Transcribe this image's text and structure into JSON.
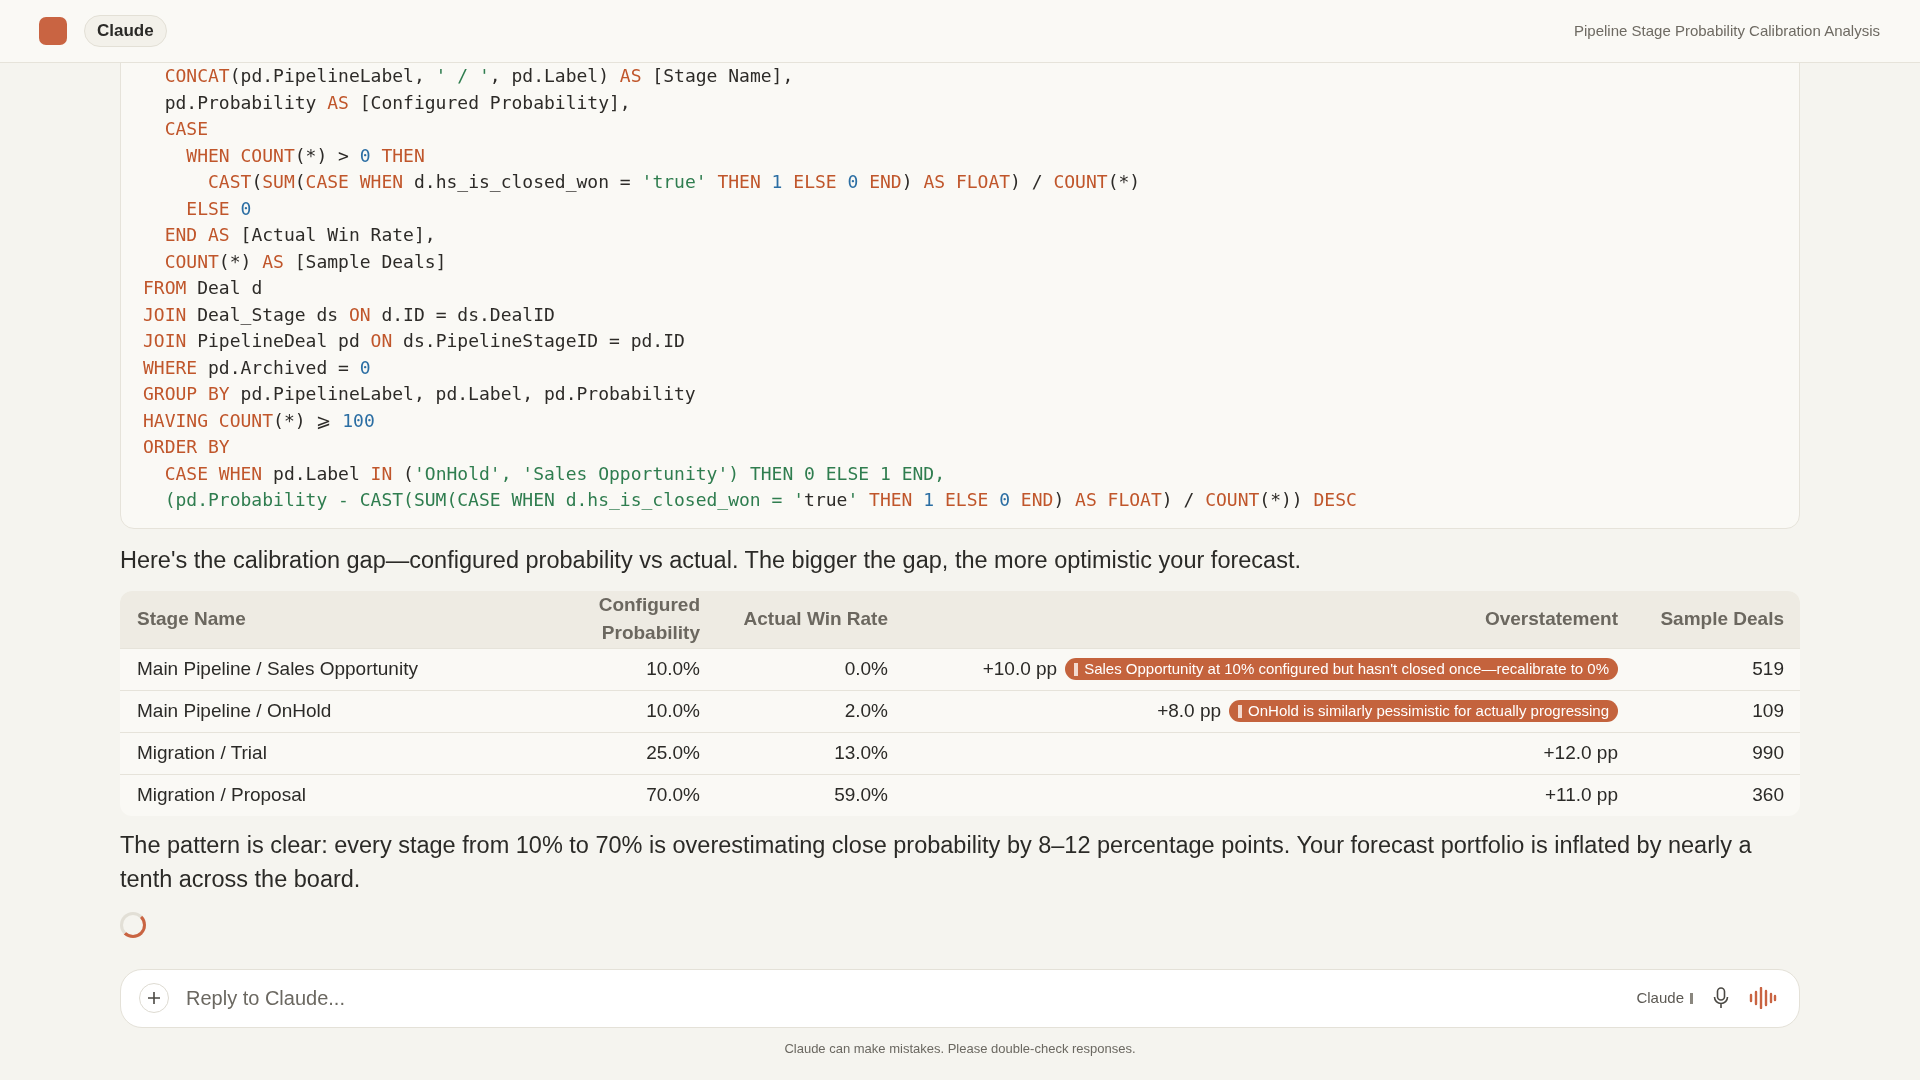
{
  "header": {
    "app_name": "Claude",
    "title": "Pipeline Stage Probability Calibration Analysis"
  },
  "code_lines": [
    [
      {
        "text": "  CONCAT",
        "kind": "kw"
      },
      {
        "text": "(pd.PipelineLabel, ",
        "kind": "plain"
      },
      {
        "text": "' / '",
        "kind": "str"
      },
      {
        "text": ", pd.Label) ",
        "kind": "plain"
      },
      {
        "text": "AS",
        "kind": "kw"
      },
      {
        "text": " [Stage Name],",
        "kind": "plain"
      }
    ],
    [
      {
        "text": "  pd.Probability ",
        "kind": "plain"
      },
      {
        "text": "AS",
        "kind": "kw"
      },
      {
        "text": " [Configured Probability],",
        "kind": "plain"
      }
    ],
    [
      {
        "text": "  CASE",
        "kind": "kw"
      }
    ],
    [
      {
        "text": "    WHEN COUNT",
        "kind": "kw"
      },
      {
        "text": "(*) > ",
        "kind": "plain"
      },
      {
        "text": "0",
        "kind": "num"
      },
      {
        "text": " THEN",
        "kind": "kw"
      }
    ],
    [
      {
        "text": "      CAST",
        "kind": "kw"
      },
      {
        "text": "(",
        "kind": "plain"
      },
      {
        "text": "SUM",
        "kind": "kw"
      },
      {
        "text": "(",
        "kind": "plain"
      },
      {
        "text": "CASE WHEN",
        "kind": "kw"
      },
      {
        "text": " d.hs_is_closed_won = ",
        "kind": "plain"
      },
      {
        "text": "'true'",
        "kind": "str"
      },
      {
        "text": " THEN ",
        "kind": "kw"
      },
      {
        "text": "1",
        "kind": "num"
      },
      {
        "text": " ELSE ",
        "kind": "kw"
      },
      {
        "text": "0",
        "kind": "num"
      },
      {
        "text": " END",
        "kind": "kw"
      },
      {
        "text": ") ",
        "kind": "plain"
      },
      {
        "text": "AS FLOAT",
        "kind": "kw"
      },
      {
        "text": ") / ",
        "kind": "plain"
      },
      {
        "text": "COUNT",
        "kind": "kw"
      },
      {
        "text": "(*)",
        "kind": "plain"
      }
    ],
    [
      {
        "text": "    ELSE ",
        "kind": "kw"
      },
      {
        "text": "0",
        "kind": "num"
      }
    ],
    [
      {
        "text": "  END AS",
        "kind": "kw"
      },
      {
        "text": " [Actual Win Rate],",
        "kind": "plain"
      }
    ],
    [
      {
        "text": "  COUNT",
        "kind": "kw"
      },
      {
        "text": "(*) ",
        "kind": "plain"
      },
      {
        "text": "AS",
        "kind": "kw"
      },
      {
        "text": " [Sample Deals]",
        "kind": "plain"
      }
    ],
    [
      {
        "text": "FROM",
        "kind": "kw"
      },
      {
        "text": " Deal d",
        "kind": "plain"
      }
    ],
    [
      {
        "text": "JOIN",
        "kind": "kw"
      },
      {
        "text": " Deal_Stage ds ",
        "kind": "plain"
      },
      {
        "text": "ON",
        "kind": "kw"
      },
      {
        "text": " d.ID = ds.DealID",
        "kind": "plain"
      }
    ],
    [
      {
        "text": "JOIN",
        "kind": "kw"
      },
      {
        "text": " PipelineDeal pd ",
        "kind": "plain"
      },
      {
        "text": "ON",
        "kind": "kw"
      },
      {
        "text": " ds.PipelineStageID = pd.ID",
        "kind": "plain"
      }
    ],
    [
      {
        "text": "WHERE",
        "kind": "kw"
      },
      {
        "text": " pd.Archived = ",
        "kind": "plain"
      },
      {
        "text": "0",
        "kind": "num"
      }
    ],
    [
      {
        "text": "GROUP BY",
        "kind": "kw"
      },
      {
        "text": " pd.PipelineLabel, pd.Label, pd.Probability",
        "kind": "plain"
      }
    ],
    [
      {
        "text": "HAVING COUNT",
        "kind": "kw"
      },
      {
        "text": "(*) ⩾ ",
        "kind": "plain"
      },
      {
        "text": "100",
        "kind": "num"
      }
    ],
    [
      {
        "text": "ORDER BY",
        "kind": "kw"
      }
    ],
    [
      {
        "text": "  CASE WHEN",
        "kind": "kw"
      },
      {
        "text": " pd.Label ",
        "kind": "plain"
      },
      {
        "text": "IN",
        "kind": "kw"
      },
      {
        "text": " (",
        "kind": "plain"
      },
      {
        "text": "'OnHold', 'Sales Opportunity') THEN 0 ELSE 1 END,",
        "kind": "str"
      }
    ],
    [
      {
        "text": "  (pd.Probability - CAST(SUM(CASE WHEN d.hs_is_closed_won = '",
        "kind": "str"
      },
      {
        "text": "true",
        "kind": "plain"
      },
      {
        "text": "'",
        "kind": "str"
      },
      {
        "text": " THEN ",
        "kind": "kw"
      },
      {
        "text": "1",
        "kind": "num"
      },
      {
        "text": " ELSE ",
        "kind": "kw"
      },
      {
        "text": "0",
        "kind": "num"
      },
      {
        "text": " END",
        "kind": "kw"
      },
      {
        "text": ") ",
        "kind": "plain"
      },
      {
        "text": "AS FLOAT",
        "kind": "kw"
      },
      {
        "text": ") / ",
        "kind": "plain"
      },
      {
        "text": "COUNT",
        "kind": "kw"
      },
      {
        "text": "(*)) ",
        "kind": "plain"
      },
      {
        "text": "DESC",
        "kind": "kw"
      }
    ]
  ],
  "intro": "Here's the calibration gap—configured probability vs actual. The bigger the gap, the more optimistic your forecast.",
  "table": {
    "columns": [
      "Stage Name",
      "Configured Probability",
      "Actual Win Rate",
      "Overstatement",
      "Sample Deals"
    ],
    "rows": [
      {
        "stage": "Main Pipeline / Sales Opportunity",
        "configured": "10.0%",
        "actual": "0.0%",
        "overstatement": "+10.0 pp",
        "note": "Sales Opportunity at 10% configured but hasn't closed once—recalibrate to 0%",
        "sample": "519"
      },
      {
        "stage": "Main Pipeline / OnHold",
        "configured": "10.0%",
        "actual": "2.0%",
        "overstatement": "+8.0 pp",
        "note": "OnHold is similarly pessimistic for actually progressing",
        "sample": "109"
      },
      {
        "stage": "Migration / Trial",
        "configured": "25.0%",
        "actual": "13.0%",
        "overstatement": "+12.0 pp",
        "sample": "990"
      },
      {
        "stage": "Migration / Proposal",
        "configured": "70.0%",
        "actual": "59.0%",
        "overstatement": "+11.0 pp",
        "sample": "360"
      }
    ]
  },
  "summary": "The pattern is clear: every stage from 10% to 70% is overestimating close probability by 8–12 percentage points. Your forecast portfolio is inflated by nearly a tenth across the board.",
  "composer": {
    "placeholder": "Reply to Claude...",
    "model": "Claude"
  },
  "disclaimer": "Claude can make mistakes. Please double-check responses."
}
